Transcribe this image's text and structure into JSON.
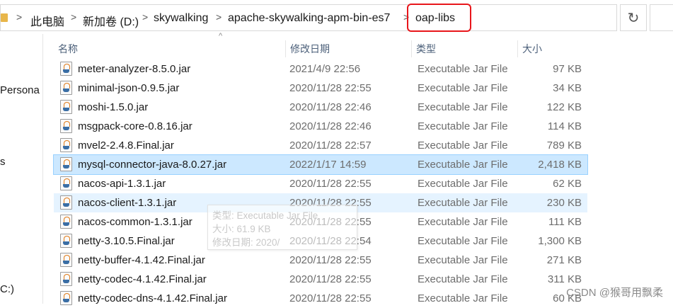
{
  "breadcrumb": [
    "此电脑",
    "新加卷 (D:)",
    "skywalking",
    "apache-skywalking-apm-bin-es7",
    "oap-libs"
  ],
  "nav": [
    "Persona",
    "s",
    "C:)"
  ],
  "columns": {
    "name": "名称",
    "date": "修改日期",
    "type": "类型",
    "size": "大小"
  },
  "files": [
    {
      "name": "meter-analyzer-8.5.0.jar",
      "date": "2021/4/9 22:56",
      "type": "Executable Jar File",
      "size": "97 KB"
    },
    {
      "name": "minimal-json-0.9.5.jar",
      "date": "2020/11/28 22:55",
      "type": "Executable Jar File",
      "size": "34 KB"
    },
    {
      "name": "moshi-1.5.0.jar",
      "date": "2020/11/28 22:46",
      "type": "Executable Jar File",
      "size": "122 KB"
    },
    {
      "name": "msgpack-core-0.8.16.jar",
      "date": "2020/11/28 22:46",
      "type": "Executable Jar File",
      "size": "114 KB"
    },
    {
      "name": "mvel2-2.4.8.Final.jar",
      "date": "2020/11/28 22:57",
      "type": "Executable Jar File",
      "size": "789 KB"
    },
    {
      "name": "mysql-connector-java-8.0.27.jar",
      "date": "2022/1/17 14:59",
      "type": "Executable Jar File",
      "size": "2,418 KB"
    },
    {
      "name": "nacos-api-1.3.1.jar",
      "date": "2020/11/28 22:55",
      "type": "Executable Jar File",
      "size": "62 KB"
    },
    {
      "name": "nacos-client-1.3.1.jar",
      "date": "2020/11/28 22:55",
      "type": "Executable Jar File",
      "size": "230 KB"
    },
    {
      "name": "nacos-common-1.3.1.jar",
      "date": "2020/11/28 22:55",
      "type": "Executable Jar File",
      "size": "111 KB"
    },
    {
      "name": "netty-3.10.5.Final.jar",
      "date": "2020/11/28 22:54",
      "type": "Executable Jar File",
      "size": "1,300 KB"
    },
    {
      "name": "netty-buffer-4.1.42.Final.jar",
      "date": "2020/11/28 22:55",
      "type": "Executable Jar File",
      "size": "271 KB"
    },
    {
      "name": "netty-codec-4.1.42.Final.jar",
      "date": "2020/11/28 22:55",
      "type": "Executable Jar File",
      "size": "311 KB"
    },
    {
      "name": "netty-codec-dns-4.1.42.Final.jar",
      "date": "2020/11/28 22:55",
      "type": "Executable Jar File",
      "size": "60 KB"
    }
  ],
  "tooltip": {
    "line1": "类型: Executable Jar File",
    "line2": "大小: 61.9 KB",
    "line3": "修改日期: 2020/"
  },
  "watermark": "CSDN @猴哥用飘柔",
  "icons": {
    "refresh": "refresh-icon",
    "jar": "jar-file-icon",
    "folder": "folder-icon"
  },
  "colors": {
    "highlight_box": "#e8161b",
    "selected_row": "#cce8ff"
  }
}
